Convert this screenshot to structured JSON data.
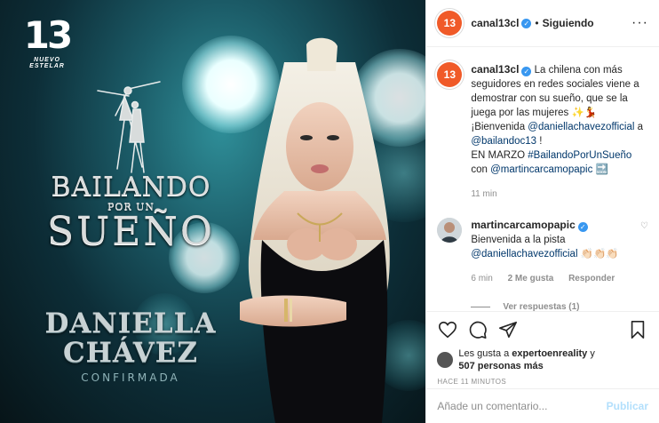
{
  "media": {
    "logo_number": "13",
    "logo_sub": "NUEVO ESTELAR",
    "show_title_1": "BAILANDO",
    "show_title_2": "POR UN",
    "show_title_3": "SUEÑO",
    "guest_first": "DANIELLA",
    "guest_last": "CHÁVEZ",
    "guest_status": "CONFIRMADA"
  },
  "header": {
    "avatar_text": "13",
    "username": "canal13cl",
    "dot": "•",
    "follow_label": "Siguiendo",
    "more": "···"
  },
  "caption": {
    "username": "canal13cl",
    "text_1": " La chilena con más seguidores en redes sociales viene a demostrar con su sueño, que se la juega por las mujeres ✨💃",
    "text_2": "¡Bienvenida ",
    "mention_1": "@daniellachavezofficial",
    "text_3": " a ",
    "mention_2": "@bailandoc13",
    "text_4": " !",
    "text_5": "EN MARZO ",
    "hashtag": "#BailandoPorUnSueño",
    "text_6": " con ",
    "mention_3": "@martincarcamopapic",
    "text_7": " 🔜",
    "time": "11 min"
  },
  "comment": {
    "username": "martincarcamopapic",
    "text_1": "Bienvenida a la pista ",
    "mention": "@daniellachavezofficial",
    "text_2": " 👏🏻👏🏻👏🏻",
    "time": "6 min",
    "likes": "2 Me gusta",
    "reply": "Responder",
    "view_replies": "Ver respuestas (1)"
  },
  "likes": {
    "prefix": "Les gusta a ",
    "user": "expertoenreality",
    "mid": " y ",
    "count": "507 personas más"
  },
  "timestamp": "HACE 11 MINUTOS",
  "add_comment": {
    "placeholder": "Añade un comentario...",
    "publish": "Publicar"
  }
}
